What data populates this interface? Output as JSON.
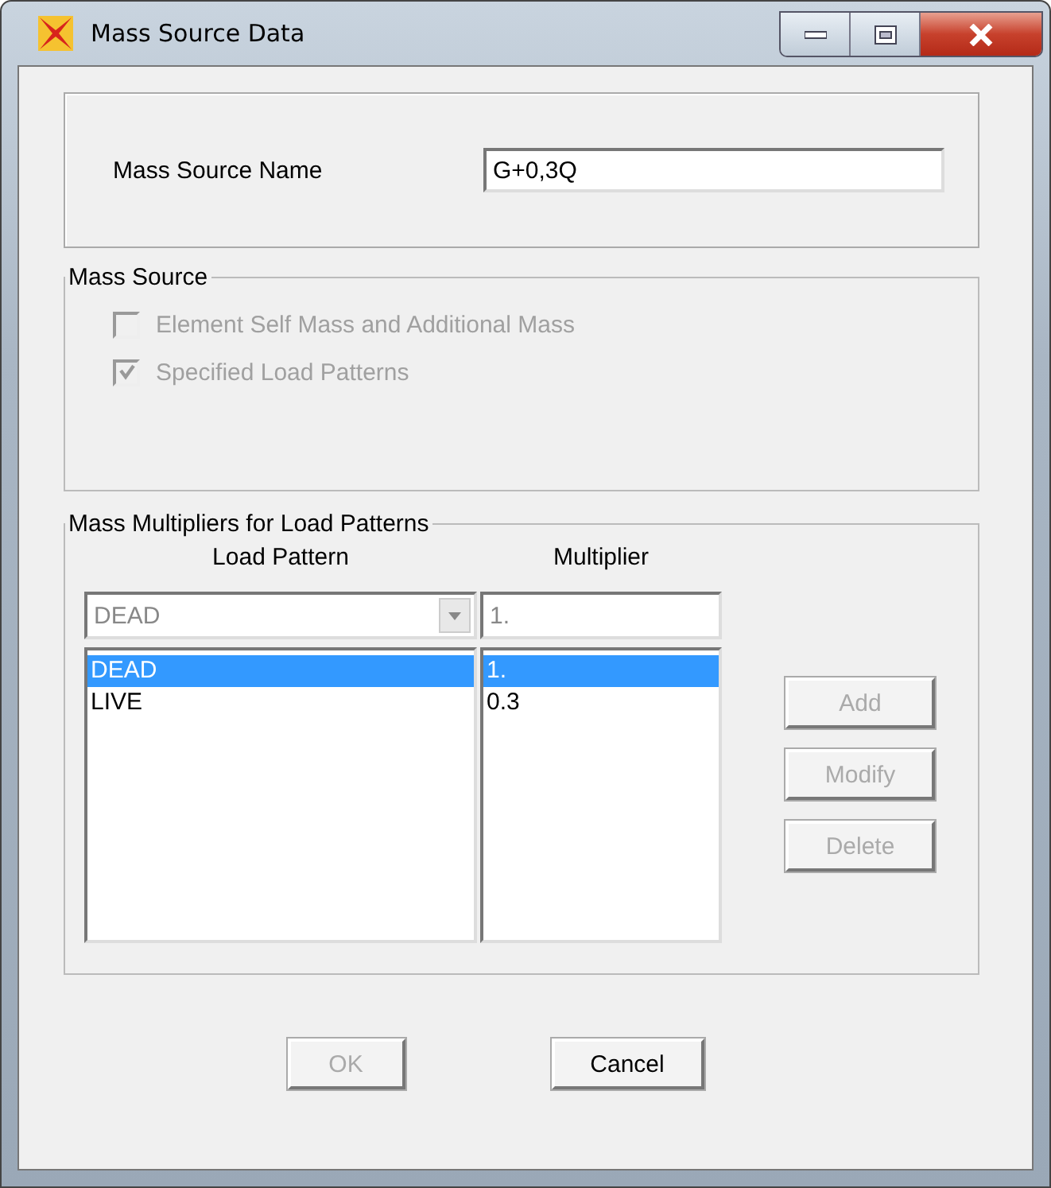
{
  "window": {
    "title": "Mass Source Data"
  },
  "mass_source_name": {
    "label": "Mass Source Name",
    "value": "G+0,3Q"
  },
  "mass_source": {
    "title": "Mass Source",
    "options": [
      {
        "label": "Element Self Mass and Additional Mass",
        "checked": false,
        "disabled": true
      },
      {
        "label": "Specified Load Patterns",
        "checked": true,
        "disabled": true
      }
    ]
  },
  "multipliers": {
    "title": "Mass Multipliers for Load Patterns",
    "columns": [
      "Load Pattern",
      "Multiplier"
    ],
    "load_pattern_select": {
      "value": "DEAD",
      "disabled": true
    },
    "multiplier_input": {
      "value": "1.",
      "disabled": true
    },
    "rows": [
      {
        "load_pattern": "DEAD",
        "multiplier": "1.",
        "selected": true
      },
      {
        "load_pattern": "LIVE",
        "multiplier": "0.3",
        "selected": false
      }
    ],
    "buttons": [
      {
        "label": "Add",
        "disabled": true
      },
      {
        "label": "Modify",
        "disabled": true
      },
      {
        "label": "Delete",
        "disabled": true
      }
    ]
  },
  "buttons": [
    {
      "label": "OK",
      "disabled": true
    },
    {
      "label": "Cancel",
      "disabled": false
    }
  ]
}
